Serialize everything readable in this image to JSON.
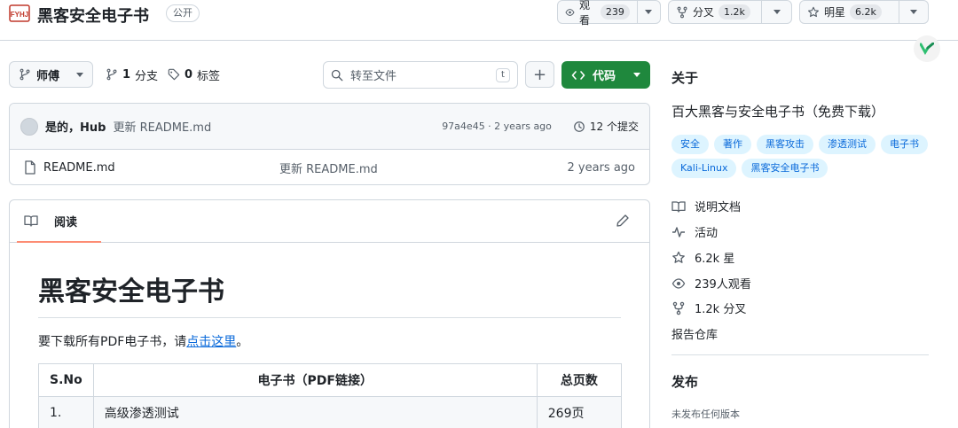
{
  "repo": {
    "title": "黑客安全电子书",
    "visibility": "公开",
    "logo_text": "FYHJ"
  },
  "header_buttons": {
    "watch": {
      "label": "观看",
      "count": "239"
    },
    "fork": {
      "label": "分叉",
      "count": "1.2k"
    },
    "star": {
      "label": "明星",
      "count": "6.2k"
    }
  },
  "toolbar": {
    "branch": "师傅",
    "branches_count": "1",
    "branches_label": "分支",
    "tags_count": "0",
    "tags_label": "标签",
    "search_placeholder": "转至文件",
    "search_kbd": "t",
    "add_label": "+",
    "code_label": "代码"
  },
  "commit": {
    "author": "是的，Hub",
    "message": "更新 README.md",
    "meta": "97a4e45 · 2 years ago",
    "count_label": "12 个提交"
  },
  "files": [
    {
      "name": "README.md",
      "message": "更新 README.md",
      "date": "2 years ago"
    }
  ],
  "readme": {
    "tab_label": "阅读",
    "heading": "黑客安全电子书",
    "para_prefix": "要下载所有PDF电子书，请",
    "para_link": "点击这里",
    "para_suffix": "。",
    "table": {
      "headers": [
        "S.No",
        "电子书（PDF链接）",
        "总页数"
      ],
      "rows": [
        [
          "1.",
          "高级渗透测试",
          "269页"
        ]
      ]
    }
  },
  "sidebar": {
    "about_title": "关于",
    "description": "百大黑客与安全电子书（免费下载）",
    "topics": [
      "安全",
      "著作",
      "黑客攻击",
      "渗透测试",
      "电子书",
      "Kali-Linux",
      "黑客安全电子书"
    ],
    "items": {
      "readme": "说明文档",
      "activity": "活动",
      "stars": "6.2k 星",
      "watchers": "239人观看",
      "forks": "1.2k 分叉",
      "report": "报告仓库"
    },
    "releases_title": "发布",
    "releases_empty": "未发布任何版本"
  },
  "colors": {
    "accent_green": "#1f883d",
    "link_blue": "#0969da",
    "tab_underline": "#fd8c73",
    "topic_bg": "#ddf4ff"
  }
}
